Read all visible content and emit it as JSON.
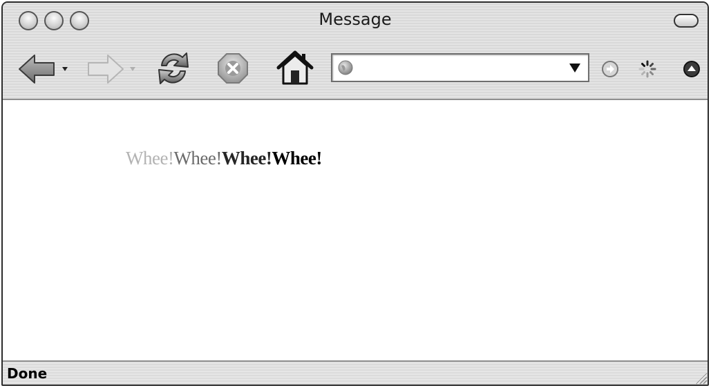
{
  "window": {
    "title": "Message"
  },
  "navigation": {
    "back_icon": "back-arrow-icon",
    "forward_icon": "forward-arrow-icon",
    "reload_icon": "reload-icon",
    "stop_icon": "stop-icon",
    "home_icon": "home-icon",
    "go_icon": "go-icon",
    "throbber_icon": "throbber-icon",
    "menu_icon": "menu-icon"
  },
  "urlbar": {
    "value": "",
    "site_icon": "globe-icon",
    "dropdown_icon": "dropdown-arrow-icon"
  },
  "content": {
    "segments": [
      "Whee!",
      "Whee!",
      "Whee!",
      "Whee!"
    ]
  },
  "status": {
    "text": "Done"
  },
  "colors": {
    "segment_1": "#b3b3b3",
    "segment_2": "#6b6b6b",
    "segment_3": "#262626",
    "segment_4": "#000000"
  }
}
